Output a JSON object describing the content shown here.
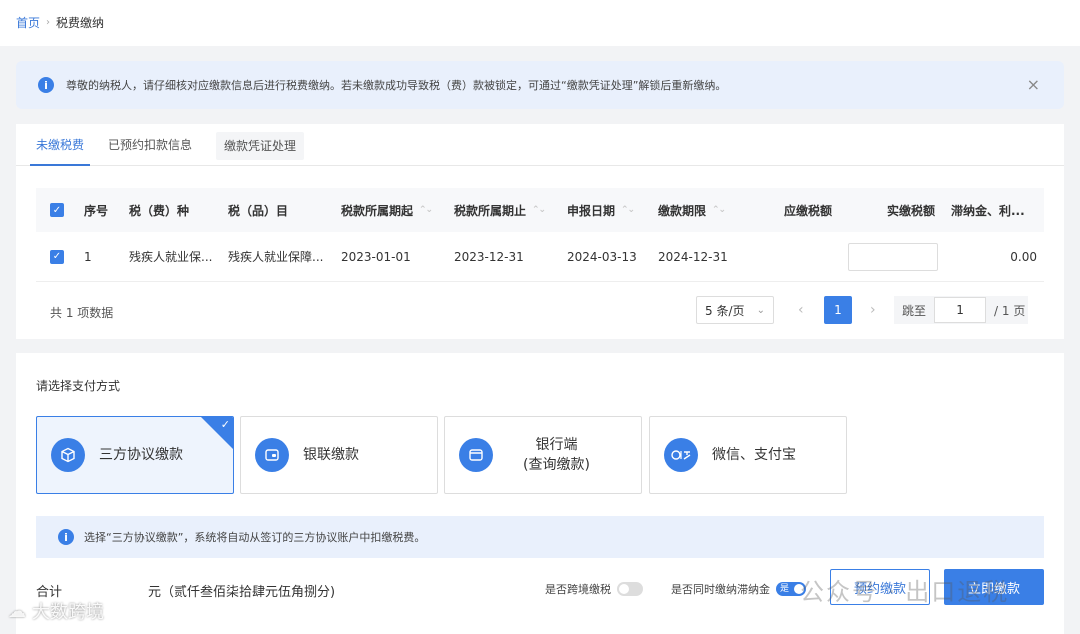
{
  "breadcrumb": {
    "home": "首页",
    "current": "税费缴纳"
  },
  "alert": {
    "text": "尊敬的纳税人，请仔细核对应缴款信息后进行税费缴纳。若未缴款成功导致税（费）款被锁定，可通过“缴款凭证处理”解锁后重新缴纳。",
    "close": "×"
  },
  "tabs": [
    {
      "label": "未缴税费",
      "active": true
    },
    {
      "label": "已预约扣款信息",
      "active": false
    },
    {
      "label": "缴款凭证处理",
      "active": false
    }
  ],
  "table": {
    "headers": [
      "序号",
      "税（费）种",
      "税（品）目",
      "税款所属期起",
      "税款所属期止",
      "申报日期",
      "缴款期限",
      "应缴税额",
      "实缴税额",
      "滞纳金、利..."
    ],
    "rows": [
      {
        "no": "1",
        "tax_type": "残疾人就业保...",
        "tax_item": "残疾人就业保障...",
        "period_start": "2023-01-01",
        "period_end": "2023-12-31",
        "declare_date": "2024-03-13",
        "deadline": "2024-12-31",
        "due_amount": "",
        "paid_amount": "",
        "late_fee": "0.00"
      }
    ]
  },
  "pagination": {
    "total_text": "共 1 项数据",
    "page_size": "5 条/页",
    "current_page": "1",
    "jump_label": "跳至",
    "jump_value": "1",
    "total_pages": "/ 1 页"
  },
  "payment": {
    "title": "请选择支付方式",
    "methods": [
      {
        "label": "三方协议缴款",
        "selected": true
      },
      {
        "label": "银联缴款",
        "selected": false
      },
      {
        "label_line1": "银行端",
        "label_line2": "(查询缴款)",
        "selected": false
      },
      {
        "label": "微信、支付宝",
        "selected": false
      }
    ],
    "note": "选择“三方协议缴款”，系统将自动从签订的三方协议账户中扣缴税费。"
  },
  "footer": {
    "total_label": "合计",
    "total_unit": "元（贰仟叁佰柒拾肆元伍角捌分)",
    "cross_border_label": "是否跨境缴税",
    "cross_border_on": false,
    "late_fee_label": "是否同时缴纳滞纳金",
    "late_fee_on": true,
    "late_fee_toggle_text": "是",
    "pre_button": "预约缴款",
    "pay_button": "立即缴款"
  },
  "watermarks": {
    "left": "大数跨境",
    "right_a": "公众号 ·",
    "right_b": "出口退税"
  },
  "colors": {
    "primary": "#3a7fe6",
    "alert_bg": "#e9f0fc"
  }
}
